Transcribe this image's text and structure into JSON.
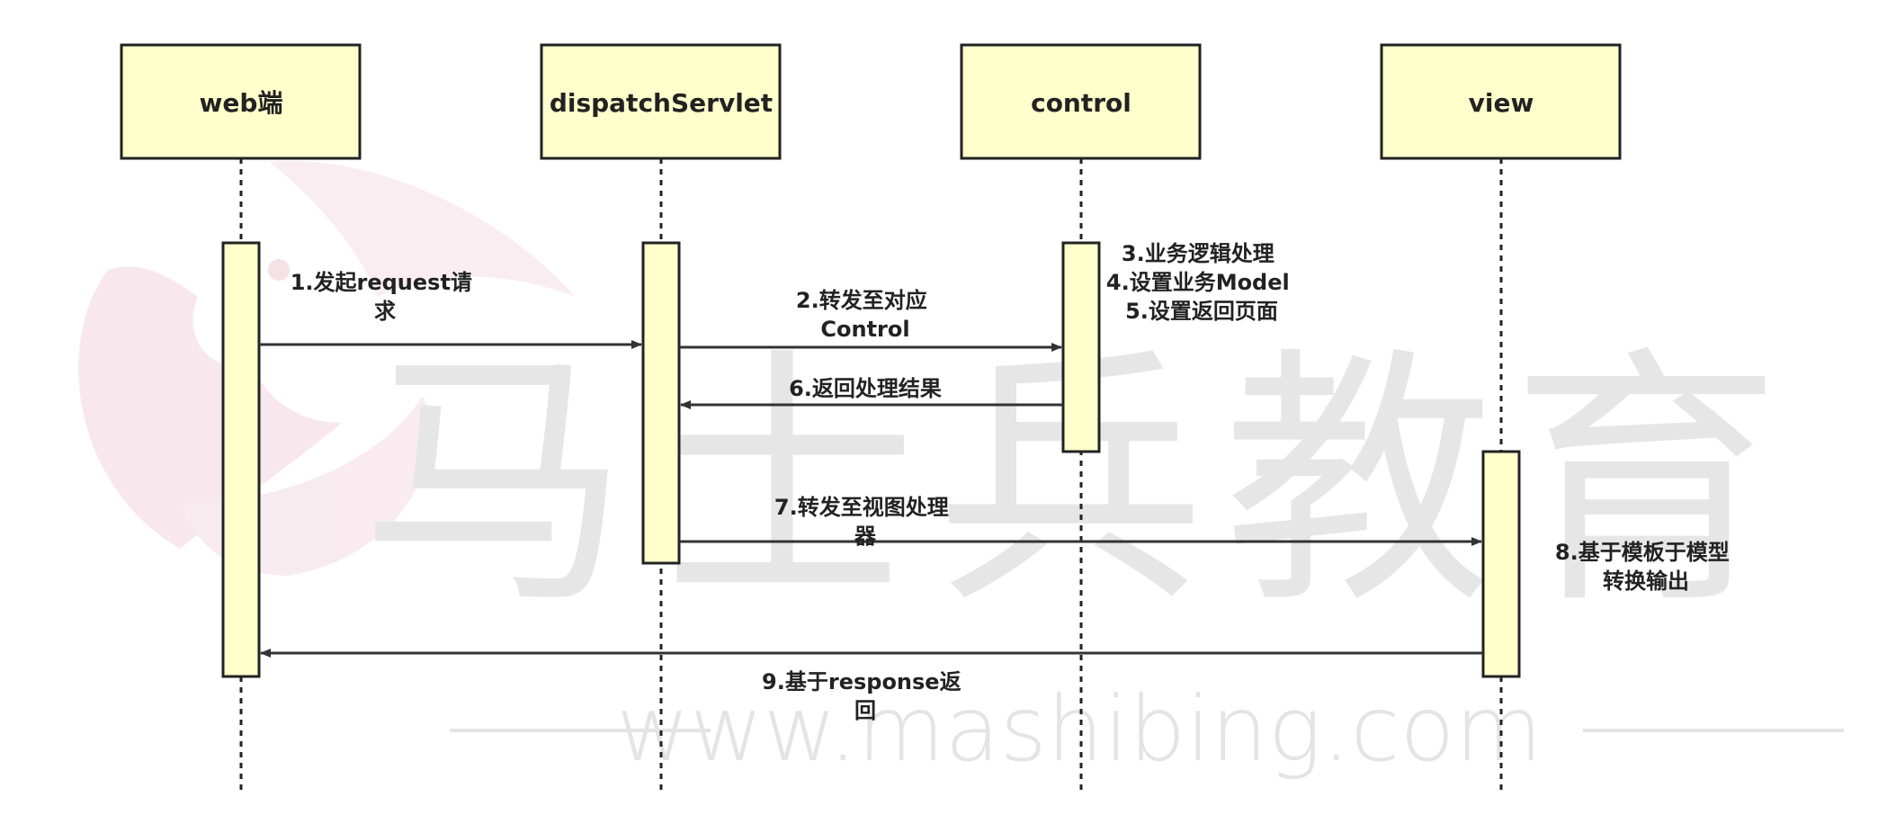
{
  "colors": {
    "box_fill": "#FFFFCC",
    "box_stroke": "#222222",
    "lifeline": "#222222",
    "arrow": "#333333",
    "watermark_text": "#e2e2e2",
    "watermark_logo": "#f6e2e8"
  },
  "actors": [
    {
      "id": "web",
      "label": "web端"
    },
    {
      "id": "dispatch",
      "label": "dispatchServlet"
    },
    {
      "id": "control",
      "label": "control"
    },
    {
      "id": "view",
      "label": "view"
    }
  ],
  "messages": [
    {
      "id": "m1",
      "from": "web",
      "to": "dispatch",
      "lines": [
        "1.发起request请",
        "求"
      ]
    },
    {
      "id": "m2",
      "from": "dispatch",
      "to": "control",
      "lines": [
        "2.转发至对应",
        "Control"
      ]
    },
    {
      "id": "m3",
      "from": "control",
      "to": "dispatch",
      "lines": [
        "6.返回处理结果"
      ]
    },
    {
      "id": "m4",
      "from": "dispatch",
      "to": "view",
      "lines": [
        "7.转发至视图处理",
        "器"
      ]
    },
    {
      "id": "m5",
      "from": "view",
      "to": "web",
      "lines": [
        "9.基于response返",
        "回"
      ]
    }
  ],
  "notes": [
    {
      "id": "control-note",
      "actor": "control",
      "lines": [
        "3.业务逻辑处理",
        "4.设置业务Model",
        "5.设置返回页面"
      ]
    },
    {
      "id": "view-note",
      "actor": "view",
      "lines": [
        "8.基于模板于模型",
        "转换输出"
      ]
    }
  ],
  "watermark": {
    "brand": "马士兵教育",
    "url": "www.mashibing.com"
  }
}
